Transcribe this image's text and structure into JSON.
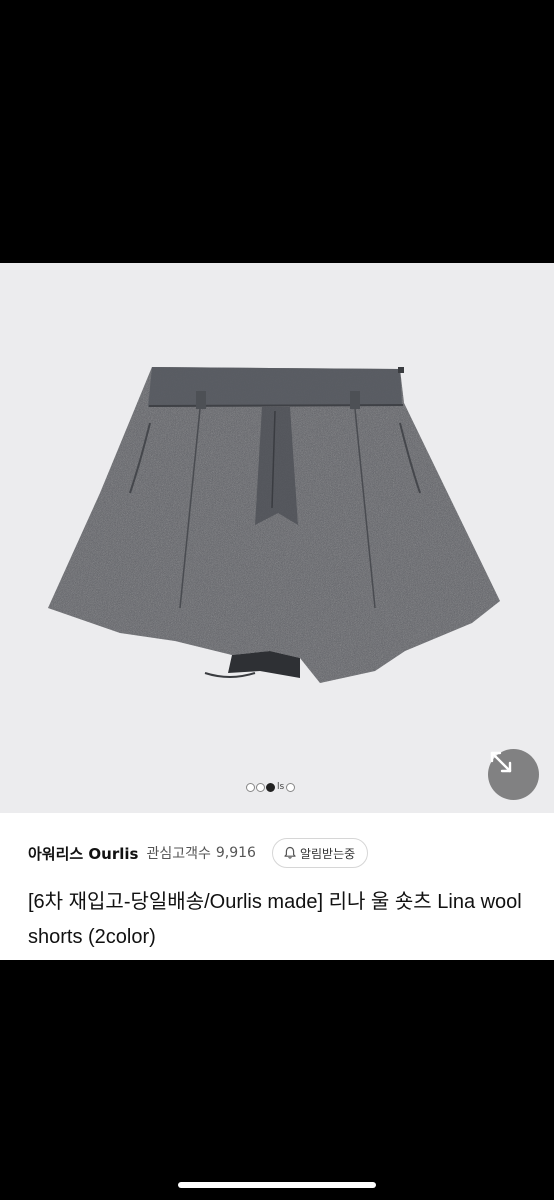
{
  "store": {
    "name": "아워리스 Ourlis",
    "follower_label": "관심고객수",
    "follower_count": "9,916",
    "notify_label": "알림받는중"
  },
  "product": {
    "title": "[6차 재입고-당일배송/Ourlis made] 리나 울 숏츠 Lina wool shorts (2color)",
    "image_description_icon": "wool-shorts-image"
  },
  "carousel": {
    "dot_count": 4,
    "active_index": 1,
    "brand_mark": "ls"
  },
  "icons": {
    "zoom": "expand-arrows-icon",
    "notify": "bell-icon"
  },
  "colors": {
    "image_background": "#ececee",
    "shorts_fabric": "#5b5d63",
    "zoom_button": "#6e6e6e"
  }
}
